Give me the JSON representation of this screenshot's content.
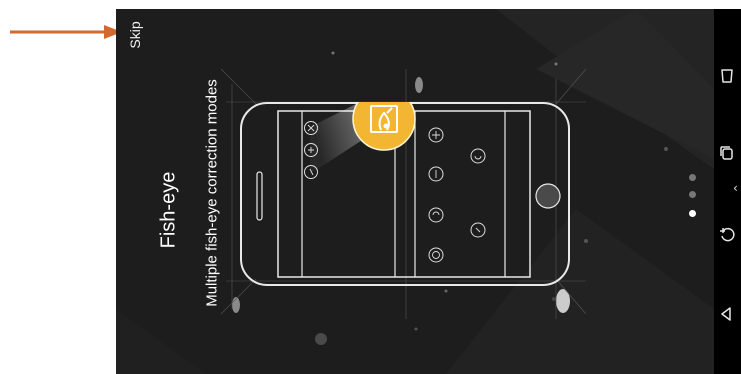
{
  "annotation": {
    "arrow_color": "#d2692e"
  },
  "onboarding": {
    "skip_label": "Skip",
    "title": "Fish-eye",
    "subtitle": "Multiple fish-eye correction modes",
    "page_count": 3,
    "current_page": 3
  },
  "colors": {
    "screen_bg": "#1d1d1d",
    "accent": "#f2b632",
    "dot_active": "#ffffff",
    "dot_inactive": "#777777"
  },
  "navbar": {
    "buttons": [
      "recent-apps-icon",
      "split-screen-icon",
      "back-icon",
      "home-icon"
    ]
  }
}
